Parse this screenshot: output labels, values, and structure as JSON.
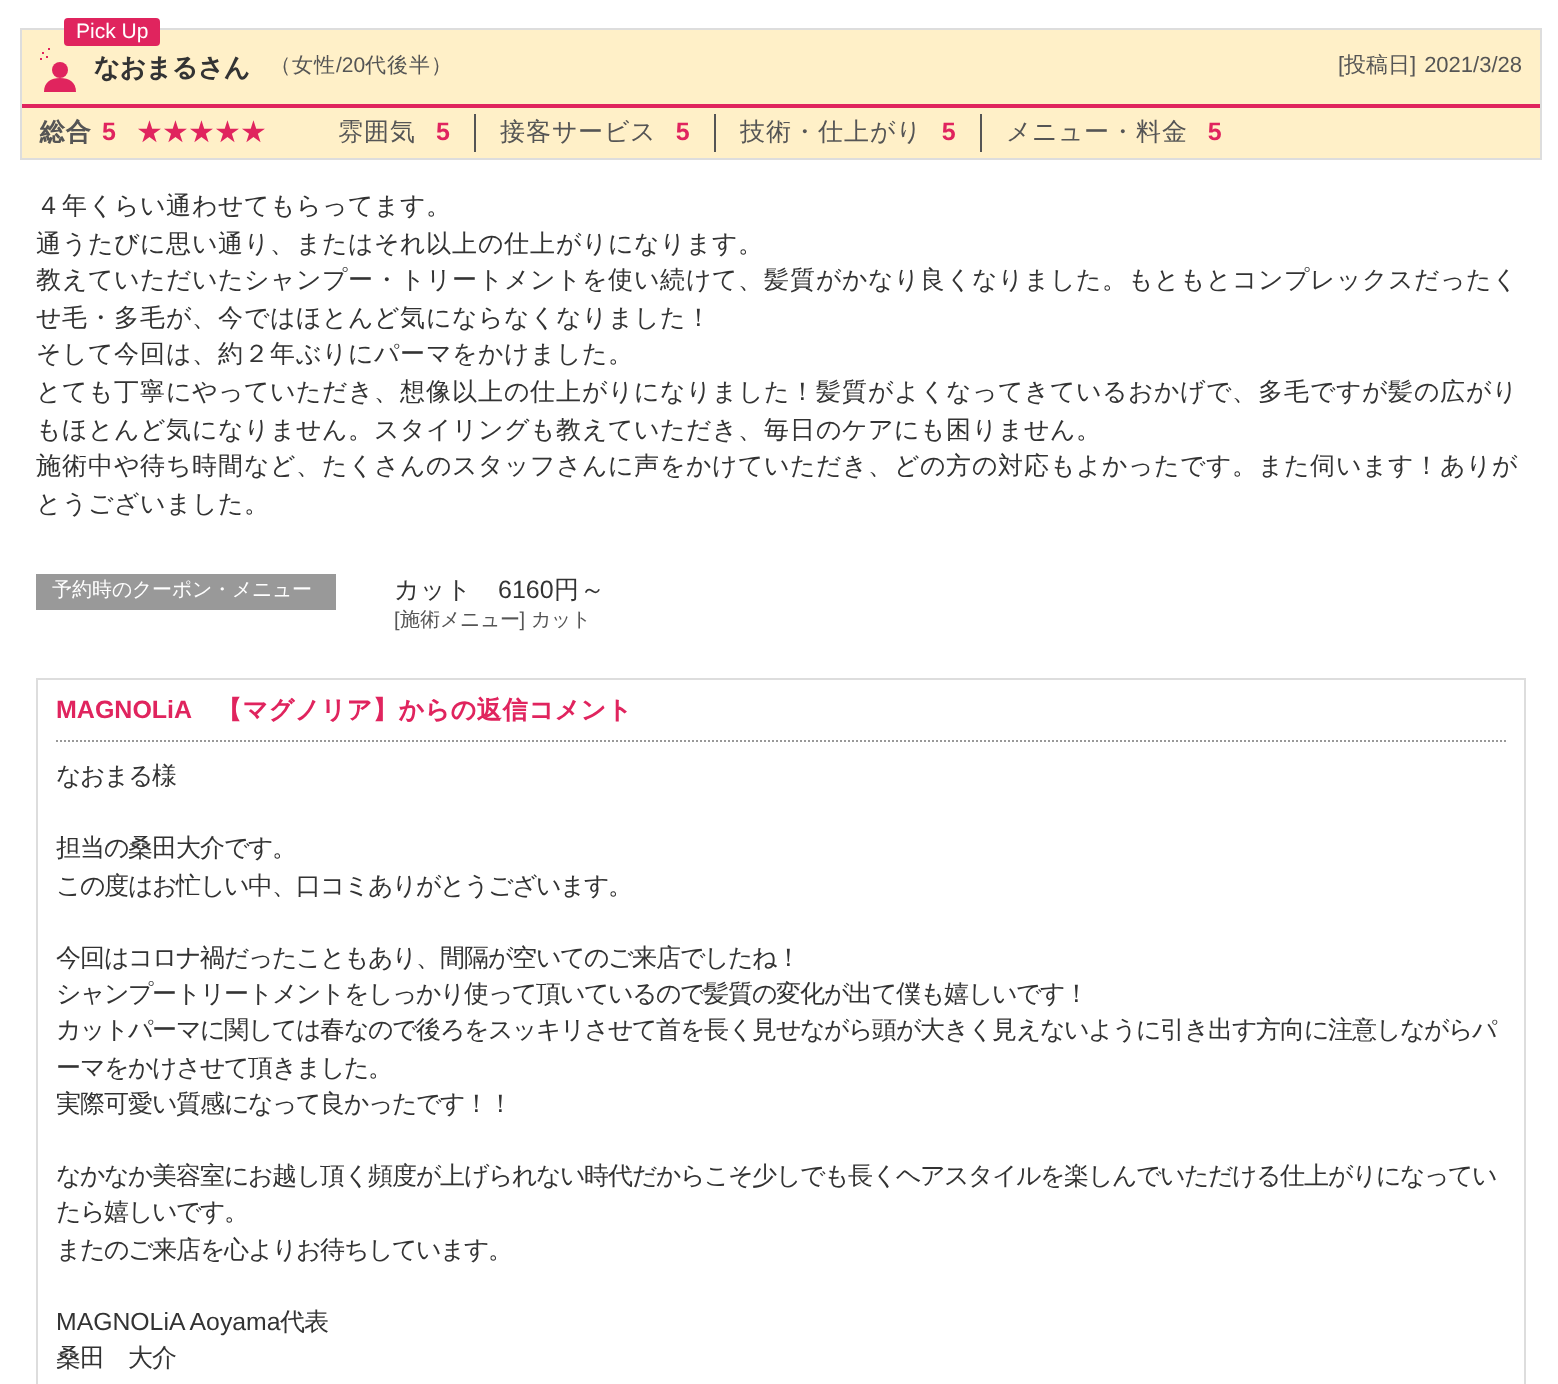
{
  "header": {
    "badge": "Pick Up",
    "name": "なおまるさん",
    "profile": "（女性/20代後半）",
    "date_label": "[投稿日]",
    "date": "2021/3/28"
  },
  "ratings": {
    "overall_label": "総合",
    "overall_score": "5",
    "stars": 5,
    "categories": [
      {
        "label": "雰囲気",
        "score": "5"
      },
      {
        "label": "接客サービス",
        "score": "5"
      },
      {
        "label": "技術・仕上がり",
        "score": "5"
      },
      {
        "label": "メニュー・料金",
        "score": "5"
      }
    ]
  },
  "review": [
    "４年くらい通わせてもらってます。",
    "通うたびに思い通り、またはそれ以上の仕上がりになります。",
    "教えていただいたシャンプー・トリートメントを使い続けて、髪質がかなり良くなりました。もともとコンプレックスだったくせ毛・多毛が、今ではほとんど気にならなくなりました！",
    "そして今回は、約２年ぶりにパーマをかけました。",
    "とても丁寧にやっていただき、想像以上の仕上がりになりました！髪質がよくなってきているおかげで、多毛ですが髪の広がりもほとんど気になりません。スタイリングも教えていただき、毎日のケアにも困りません。",
    "施術中や待ち時間など、たくさんのスタッフさんに声をかけていただき、どの方の対応もよかったです。また伺います！ありがとうございました。"
  ],
  "coupon": {
    "label": "予約時のクーポン・メニュー",
    "name": "カット　6160円～",
    "menu": "[施術メニュー] カット"
  },
  "reply": {
    "title": "MAGNOLiA　【マグノリア】からの返信コメント",
    "blocks": [
      [
        "なおまる様"
      ],
      [
        "担当の桑田大介です。",
        "この度はお忙しい中、口コミありがとうございます。"
      ],
      [
        "今回はコロナ禍だったこともあり、間隔が空いてのご来店でしたね！",
        "シャンプートリートメントをしっかり使って頂いているので髪質の変化が出て僕も嬉しいです！",
        "カットパーマに関しては春なので後ろをスッキリさせて首を長く見せながら頭が大きく見えないように引き出す方向に注意しながらパーマをかけさせて頂きました。",
        "実際可愛い質感になって良かったです！！"
      ],
      [
        "なかなか美容室にお越し頂く頻度が上げられない時代だからこそ少しでも長くヘアスタイルを楽しんでいただける仕上がりになっていたら嬉しいです。",
        "またのご来店を心よりお待ちしています。"
      ],
      [
        "MAGNOLiA Aoyama代表",
        "桑田　大介"
      ]
    ]
  }
}
